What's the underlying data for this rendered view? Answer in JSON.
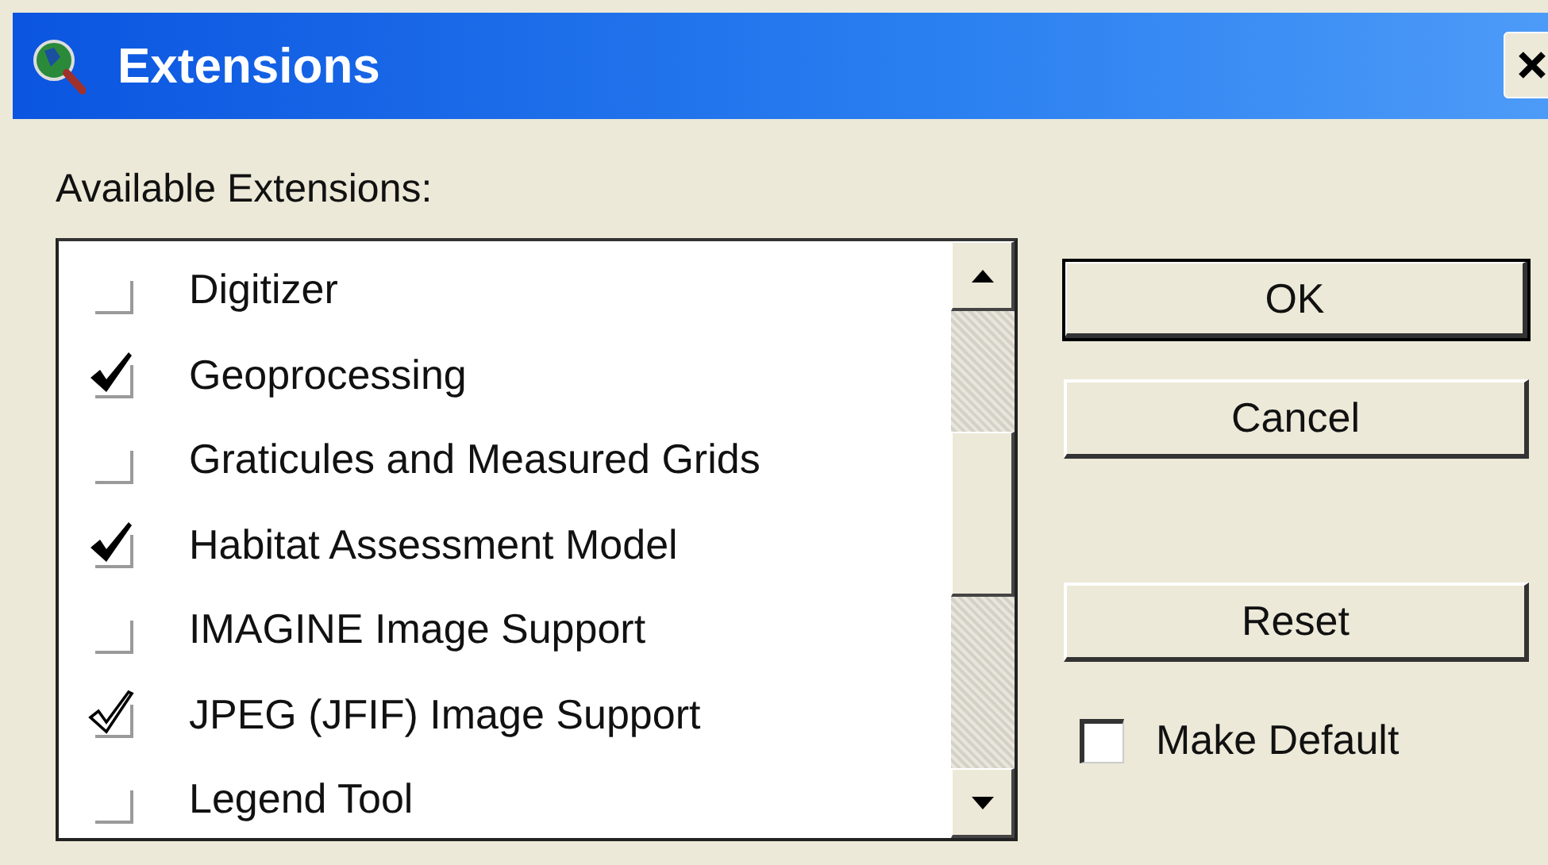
{
  "window": {
    "title": "Extensions"
  },
  "list_label": "Available Extensions:",
  "extensions": [
    {
      "name": "Digitizer",
      "kind": "empty"
    },
    {
      "name": "Geoprocessing",
      "kind": "tick"
    },
    {
      "name": "Graticules and Measured Grids",
      "kind": "empty"
    },
    {
      "name": "Habitat Assessment Model",
      "kind": "tick"
    },
    {
      "name": "IMAGINE Image Support",
      "kind": "empty"
    },
    {
      "name": "JPEG (JFIF) Image Support",
      "kind": "hollowtick"
    },
    {
      "name": "Legend Tool",
      "kind": "empty"
    }
  ],
  "buttons": [
    {
      "label": "OK",
      "default": true
    },
    {
      "label": "Cancel",
      "default": false
    },
    {
      "label": "Reset",
      "default": false
    }
  ],
  "make_default": {
    "label": "Make Default",
    "checked": false
  }
}
